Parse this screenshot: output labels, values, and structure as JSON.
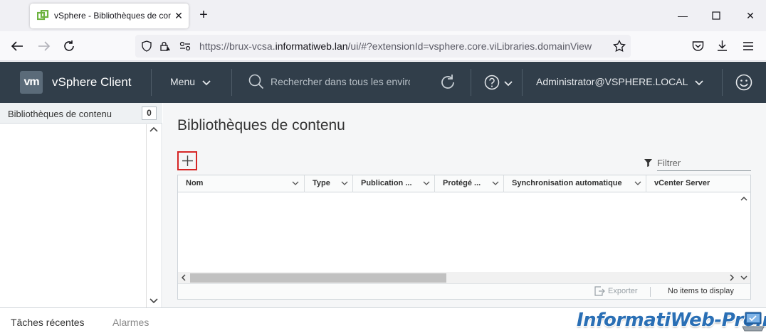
{
  "browser": {
    "tab_title": "vSphere - Bibliothèques de conte",
    "url_prefix": "https://brux-vcsa.",
    "url_host": "informatiweb.lan",
    "url_path": "/ui/#?extensionId=vsphere.core.viLibraries.domainView"
  },
  "header": {
    "logo": "vm",
    "app_title": "vSphere Client",
    "menu_label": "Menu",
    "search_placeholder": "Rechercher dans tous les environnements",
    "user": "Administrator@VSPHERE.LOCAL"
  },
  "left_panel": {
    "title": "Bibliothèques de contenu",
    "count": "0"
  },
  "main": {
    "page_title": "Bibliothèques de contenu",
    "add_label": "+",
    "filter_placeholder": "Filtrer",
    "columns": [
      {
        "label": "Nom"
      },
      {
        "label": "Type"
      },
      {
        "label": "Publication ..."
      },
      {
        "label": "Protégé ..."
      },
      {
        "label": "Synchronisation automatique"
      },
      {
        "label": "vCenter Server"
      }
    ],
    "footer": {
      "export_label": "Exporter",
      "status": "No items to display"
    }
  },
  "bottom_panel": {
    "tabs": [
      {
        "label": "Tâches récentes"
      },
      {
        "label": "Alarmes"
      }
    ],
    "watermark": "InformatiWeb-Pro.net"
  },
  "colors": {
    "header_bg": "#313e4a",
    "highlight_red": "#d62626",
    "watermark_blue": "#2a6fb5"
  }
}
